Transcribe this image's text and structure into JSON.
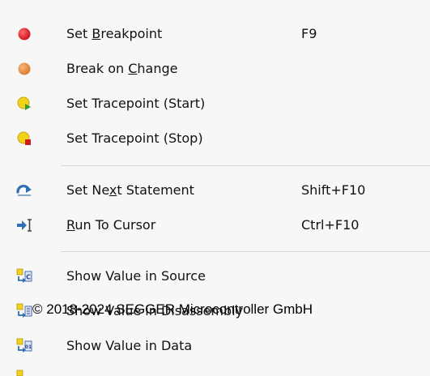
{
  "menu": {
    "items": [
      {
        "pre": "Set ",
        "ul": "B",
        "post": "reakpoint",
        "shortcut": "F9",
        "icon": "red-dot-icon"
      },
      {
        "pre": "Break on ",
        "ul": "C",
        "post": "hange",
        "shortcut": "",
        "icon": "orange-dot-icon"
      },
      {
        "pre": "Set Tracepoint (Start)",
        "ul": "",
        "post": "",
        "shortcut": "",
        "icon": "tracepoint-start-icon"
      },
      {
        "pre": "Set Tracepoint (Stop)",
        "ul": "",
        "post": "",
        "shortcut": "",
        "icon": "tracepoint-stop-icon"
      },
      {
        "pre": "Set Ne",
        "ul": "x",
        "post": "t Statement",
        "shortcut": "Shift+F10",
        "icon": "next-statement-icon"
      },
      {
        "pre": "",
        "ul": "R",
        "post": "un To Cursor",
        "shortcut": "Ctrl+F10",
        "icon": "run-to-cursor-icon"
      },
      {
        "pre": "Show Value in Source",
        "ul": "",
        "post": "",
        "shortcut": "",
        "icon": "show-in-source-icon"
      },
      {
        "pre": "Show Value in Disassembly",
        "ul": "",
        "post": "",
        "shortcut": "",
        "icon": "show-in-disassembly-icon"
      },
      {
        "pre": "Show Value in Data",
        "ul": "",
        "post": "",
        "shortcut": "",
        "icon": "show-in-data-icon"
      }
    ]
  },
  "watermark": "© 2018-2024 SEGGER Microcontroller GmbH"
}
